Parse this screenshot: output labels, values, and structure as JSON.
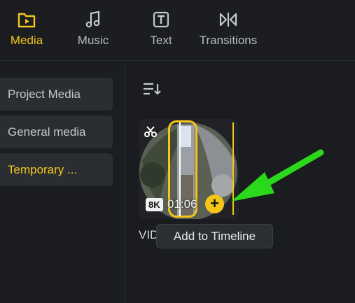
{
  "tabs": [
    {
      "label": "Media",
      "icon": "media-folder-icon",
      "active": true
    },
    {
      "label": "Music",
      "icon": "music-note-icon",
      "active": false
    },
    {
      "label": "Text",
      "icon": "text-box-icon",
      "active": false
    },
    {
      "label": "Transitions",
      "icon": "transitions-icon",
      "active": false
    }
  ],
  "sidebar": {
    "items": [
      {
        "label": "Project Media",
        "active": false
      },
      {
        "label": "General media",
        "active": false
      },
      {
        "label": "Temporary ...",
        "active": true
      }
    ]
  },
  "toolbar": {
    "sort_icon": "sort-icon"
  },
  "media_card": {
    "name": "VID",
    "resolution_badge": "8K",
    "duration": "01:06",
    "add_button": "+",
    "tooltip": "Add to Timeline"
  },
  "colors": {
    "accent": "#f5c518",
    "background": "#1a1c1f",
    "panel": "#2a2d31",
    "annotation_arrow": "#2bd81b"
  }
}
